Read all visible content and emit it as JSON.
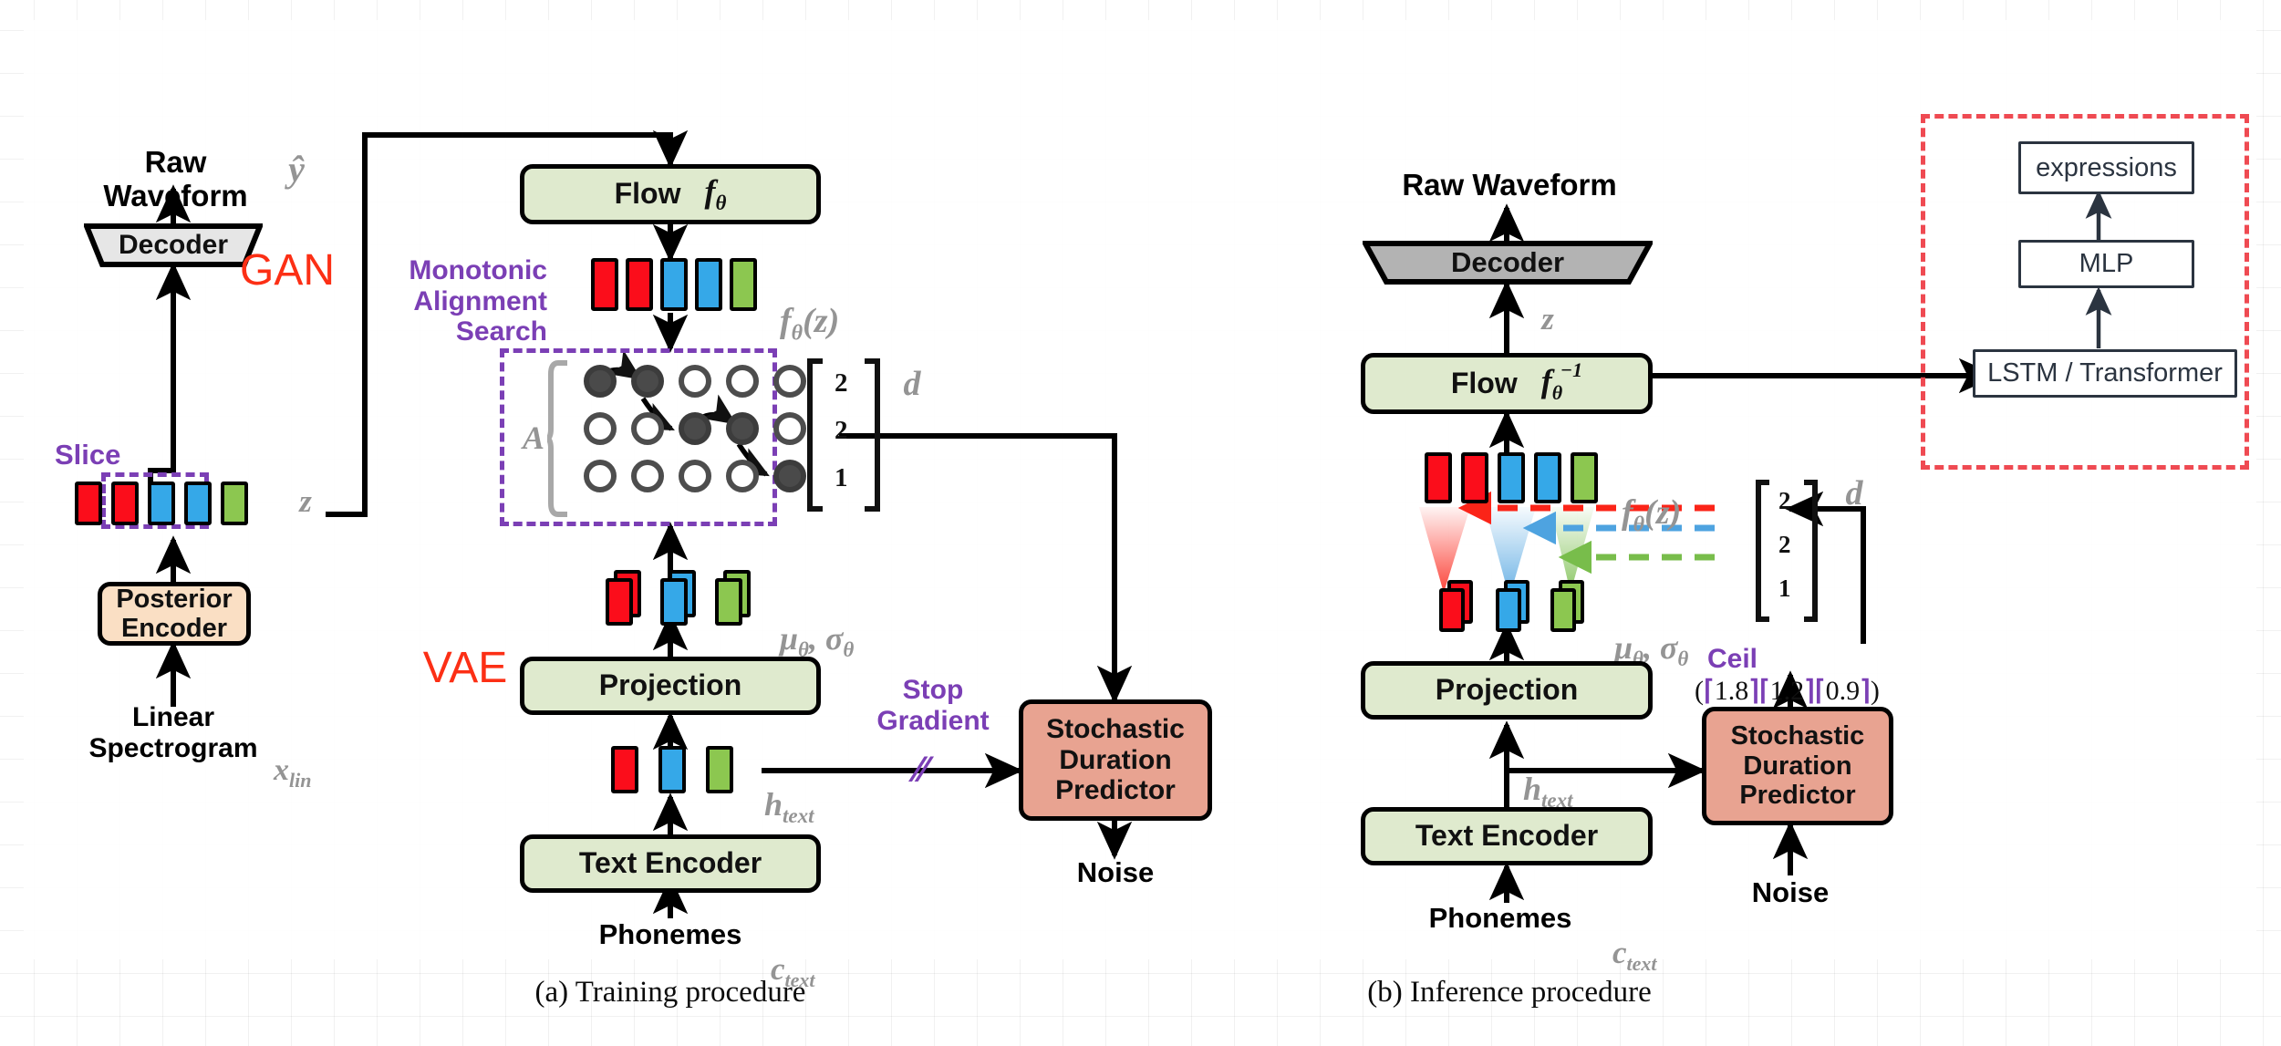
{
  "figure": {
    "caption_a": "(a) Training procedure",
    "caption_b": "(b) Inference procedure"
  },
  "training": {
    "raw_waveform_label": "Raw\nWaveform",
    "y_hat_symbol": "ŷ",
    "decoder_label": "Decoder",
    "gan_label": "GAN",
    "slice_label": "Slice",
    "z_symbol": "z",
    "posterior_encoder_label": "Posterior\nEncoder",
    "linear_spectrogram_label": "Linear\nSpectrogram",
    "x_lin_symbol": "x",
    "x_lin_sub": "lin",
    "flow_label": "Flow",
    "flow_symbol": "f",
    "flow_sub": "θ",
    "fz_symbol": "f",
    "fz_sub": "θ",
    "fz_arg": "(z)",
    "mas_label": "Monotonic\nAlignment\nSearch",
    "matrix_symbol": "A",
    "d_symbol": "d",
    "d_vector": [
      "2",
      "2",
      "1"
    ],
    "alignment_matrix": [
      [
        1,
        1,
        0,
        0,
        0
      ],
      [
        0,
        0,
        1,
        1,
        0
      ],
      [
        0,
        0,
        0,
        0,
        1
      ]
    ],
    "mu_sigma_symbol": "μ",
    "mu_sigma_sub": "θ",
    "mu_sigma_symbol2": "σ",
    "mu_sigma_sub2": "θ",
    "vae_label": "VAE",
    "projection_label": "Projection",
    "h_text_symbol": "h",
    "h_text_sub": "text",
    "stop_gradient_label": "Stop\nGradient",
    "stop_gradient_glyph": "∕∕",
    "sdp_label": "Stochastic\nDuration\nPredictor",
    "noise_label": "Noise",
    "text_encoder_label": "Text Encoder",
    "phonemes_label": "Phonemes",
    "c_text_symbol": "c",
    "c_text_sub": "text",
    "tokens_z": [
      "r",
      "r",
      "b",
      "b",
      "g"
    ],
    "tokens_fz": [
      "r",
      "r",
      "b",
      "b",
      "g"
    ],
    "tokens_mu": [
      "r",
      "b",
      "g"
    ],
    "tokens_htext": [
      "r",
      "b",
      "g"
    ]
  },
  "inference": {
    "raw_waveform_label": "Raw Waveform",
    "decoder_label": "Decoder",
    "z_symbol": "z",
    "flow_label": "Flow",
    "flow_symbol": "f",
    "flow_sub": "θ",
    "flow_sup": "−1",
    "fz_symbol": "f",
    "fz_sub": "θ",
    "fz_arg": "(z)",
    "d_symbol": "d",
    "d_vector": [
      "2",
      "2",
      "1"
    ],
    "mu_sigma_symbol": "μ",
    "mu_sigma_sub": "θ",
    "mu_sigma_symbol2": "σ",
    "mu_sigma_sub2": "θ",
    "ceil_label": "Ceil",
    "ceil_values": [
      "1.8",
      "1.2",
      "0.9"
    ],
    "ceil_open": "(",
    "ceil_close": ")",
    "ceil_left_bracket": "⌈",
    "ceil_right_bracket": "⌉",
    "projection_label": "Projection",
    "h_text_symbol": "h",
    "h_text_sub": "text",
    "sdp_label": "Stochastic\nDuration\nPredictor",
    "noise_label": "Noise",
    "text_encoder_label": "Text Encoder",
    "phonemes_label": "Phonemes",
    "c_text_symbol": "c",
    "c_text_sub": "text",
    "tokens_fz": [
      "r",
      "r",
      "b",
      "b",
      "g"
    ],
    "tokens_mu": [
      "r",
      "b",
      "g"
    ],
    "expand_colors": [
      "#fb2418",
      "#4ea3e0",
      "#78bd4b"
    ]
  },
  "expression_module": {
    "expressions_label": "expressions",
    "mlp_label": "MLP",
    "lstm_transformer_label": "LSTM / Transformer",
    "border_color": "#ef4a52"
  },
  "colors": {
    "token_red": "#fb0d1b",
    "token_blue": "#35a8e8",
    "token_green": "#8cc750",
    "green_box": "#dfeace",
    "peach_box": "#e8a391",
    "cream_box": "#fadfc4",
    "gray_box": "#e6e6e6",
    "purple": "#7b3fb5",
    "red_text": "#fc2f15",
    "gray_text": "#949494"
  }
}
